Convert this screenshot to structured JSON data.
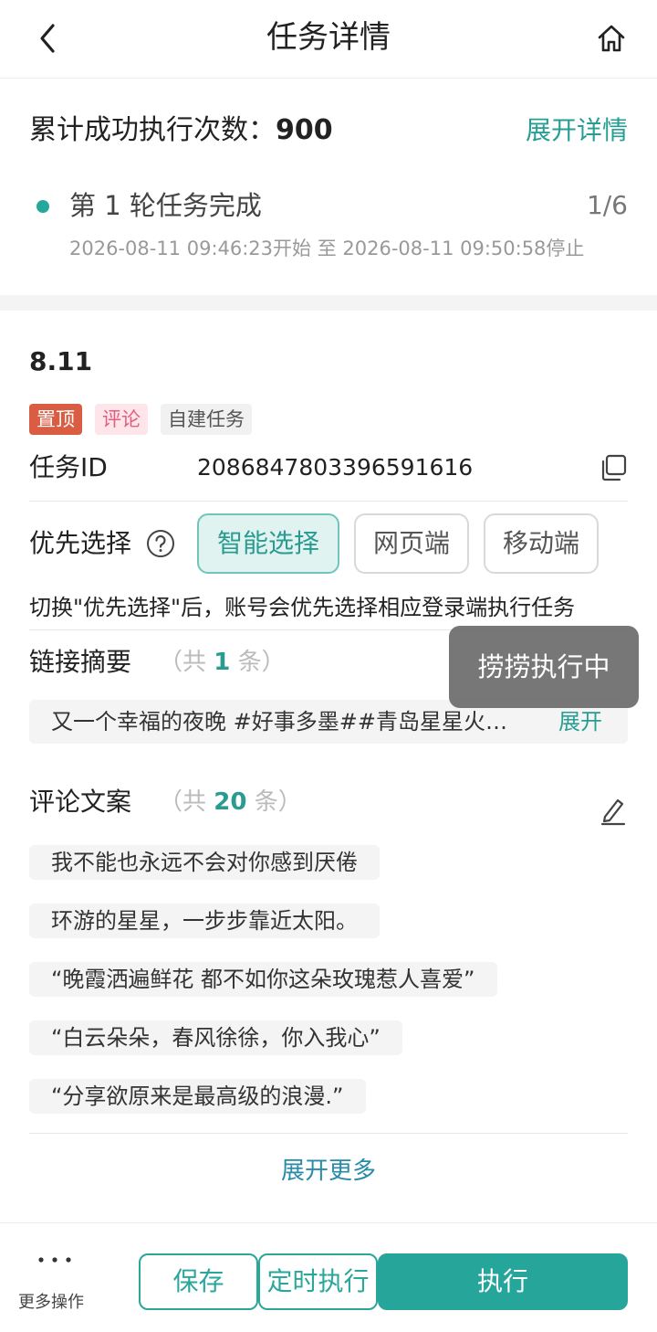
{
  "header": {
    "title": "任务详情",
    "back_icon": "chevron-left-icon",
    "home_icon": "home-icon"
  },
  "summary": {
    "count_label": "累计成功执行次数：",
    "count_value": "900",
    "expand_detail": "展开详情",
    "round_status": "第 1 轮任务完成",
    "round_count": "1/6",
    "round_time": "2026-08-11 09:46:23开始 至 2026-08-11 09:50:58停止",
    "status_dot_color": "#26a79b"
  },
  "task": {
    "name": "8.11",
    "tags": [
      "置顶",
      "评论",
      "自建任务"
    ],
    "id_label": "任务ID",
    "id_value": "2086847803396591616",
    "copy_icon": "copy-icon"
  },
  "priority": {
    "label": "优先选择",
    "help_icon": "question-circle-icon",
    "options": [
      "智能选择",
      "网页端",
      "移动端"
    ],
    "selected": "智能选择",
    "note": "切换\"优先选择\"后，账号会优先选择相应登录端执行任务"
  },
  "links": {
    "label": "链接摘要",
    "count_prefix": "（共 ",
    "count": "1",
    "count_suffix": " 条）",
    "summary_text": "又一个幸福的夜晚 #好事多墨##青岛星星火…",
    "expand": "展开"
  },
  "toast": {
    "text": "捞捞执行中"
  },
  "comments": {
    "label": "评论文案",
    "count_prefix": "（共 ",
    "count": "20",
    "count_suffix": " 条）",
    "edit_icon": "pencil-icon",
    "items": [
      "我不能也永远不会对你感到厌倦",
      "环游的星星，一步步靠近太阳。",
      "“晚霞洒遍鲜花 都不如你这朵玫瑰惹人喜爱”",
      "“白云朵朵，春风徐徐，你入我心”",
      "“分享欲原来是最高级的浪漫.”"
    ],
    "more": "展开更多"
  },
  "bottom_bar": {
    "more_icon": "more-dots-icon",
    "more_label": "更多操作",
    "save": "保存",
    "timer": "定时执行",
    "run": "执行",
    "accent_color": "#26a69a"
  }
}
